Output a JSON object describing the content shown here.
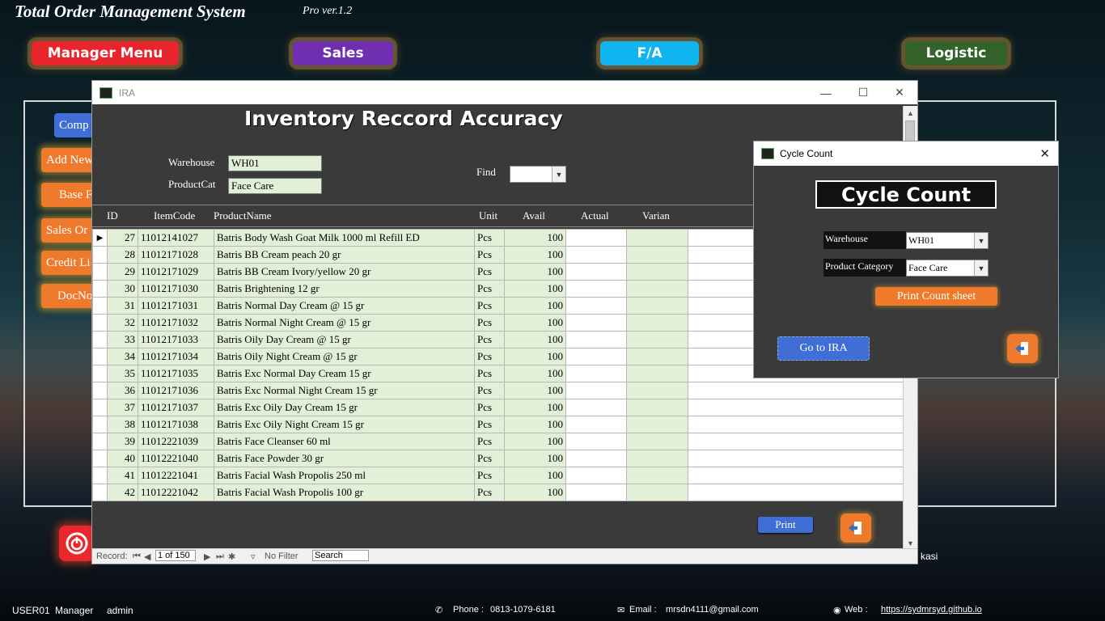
{
  "app": {
    "title": "Total Order Management System",
    "version": "Pro ver.1.2"
  },
  "menu": [
    {
      "label": "Manager Menu",
      "color": "#e8242c"
    },
    {
      "label": "Sales",
      "color": "#6f2fb0"
    },
    {
      "label": "F/A",
      "color": "#10b4ee"
    },
    {
      "label": "Logistic",
      "color": "#33632b"
    }
  ],
  "side_buttons": [
    "Comp",
    "Add New",
    "Base F",
    "Sales Or",
    "Credit Li",
    "DocNo"
  ],
  "ira": {
    "window_title": "IRA",
    "heading": "Inventory Reccord Accuracy",
    "warehouse_label": "Warehouse",
    "warehouse_value": "WH01",
    "productcat_label": "ProductCat",
    "productcat_value": "Face Care",
    "find_label": "Find",
    "find_value": "",
    "columns": [
      "ID",
      "ItemCode",
      "ProductName",
      "Unit",
      "Avail",
      "Actual",
      "Varian"
    ],
    "rows": [
      {
        "id": "27",
        "code": "11012141027",
        "name": "Batris Body Wash Goat Milk 1000 ml Refill ED",
        "unit": "Pcs",
        "avail": "100"
      },
      {
        "id": "28",
        "code": "11012171028",
        "name": "Batris BB Cream peach 20 gr",
        "unit": "Pcs",
        "avail": "100"
      },
      {
        "id": "29",
        "code": "11012171029",
        "name": "Batris BB Cream Ivory/yellow 20 gr",
        "unit": "Pcs",
        "avail": "100"
      },
      {
        "id": "30",
        "code": "11012171030",
        "name": "Batris Brightening 12 gr",
        "unit": "Pcs",
        "avail": "100"
      },
      {
        "id": "31",
        "code": "11012171031",
        "name": "Batris Normal Day Cream @ 15 gr",
        "unit": "Pcs",
        "avail": "100"
      },
      {
        "id": "32",
        "code": "11012171032",
        "name": "Batris Normal Night Cream @ 15 gr",
        "unit": "Pcs",
        "avail": "100"
      },
      {
        "id": "33",
        "code": "11012171033",
        "name": "Batris Oily Day Cream @ 15 gr",
        "unit": "Pcs",
        "avail": "100"
      },
      {
        "id": "34",
        "code": "11012171034",
        "name": "Batris Oily Night Cream @ 15 gr",
        "unit": "Pcs",
        "avail": "100"
      },
      {
        "id": "35",
        "code": "11012171035",
        "name": "Batris Exc Normal Day Cream 15 gr",
        "unit": "Pcs",
        "avail": "100"
      },
      {
        "id": "36",
        "code": "11012171036",
        "name": "Batris Exc Normal Night Cream 15 gr",
        "unit": "Pcs",
        "avail": "100"
      },
      {
        "id": "37",
        "code": "11012171037",
        "name": "Batris Exc Oily Day Cream 15 gr",
        "unit": "Pcs",
        "avail": "100"
      },
      {
        "id": "38",
        "code": "11012171038",
        "name": "Batris Exc Oily Night Cream 15 gr",
        "unit": "Pcs",
        "avail": "100"
      },
      {
        "id": "39",
        "code": "11012221039",
        "name": "Batris Face Cleanser 60 ml",
        "unit": "Pcs",
        "avail": "100"
      },
      {
        "id": "40",
        "code": "11012221040",
        "name": "Batris Face Powder 30 gr",
        "unit": "Pcs",
        "avail": "100"
      },
      {
        "id": "41",
        "code": "11012221041",
        "name": "Batris Facial Wash Propolis 250 ml",
        "unit": "Pcs",
        "avail": "100"
      },
      {
        "id": "42",
        "code": "11012221042",
        "name": "Batris Facial Wash Propolis 100 gr",
        "unit": "Pcs",
        "avail": "100"
      }
    ],
    "print_label": "Print",
    "nav": {
      "record_label": "Record:",
      "record_value": "1 of 150",
      "filter_label": "No Filter",
      "search_label": "Search"
    }
  },
  "cycle_count": {
    "window_title": "Cycle Count",
    "heading": "Cycle Count",
    "warehouse_label": "Warehouse",
    "warehouse_value": "WH01",
    "category_label": "Product Category",
    "category_value": "Face Care",
    "print_label": "Print Count sheet",
    "goto_label": "Go to IRA"
  },
  "partial_text": "kasi",
  "status": {
    "user": "USER01",
    "role": "Manager",
    "name": "admin",
    "phone_label": "Phone  :",
    "phone": "0813-1079-6181",
    "email_label": "Email   :",
    "email": "mrsdn4111@gmail.com",
    "web_label": "Web    :",
    "web": "https://sydmrsyd.github.io"
  }
}
